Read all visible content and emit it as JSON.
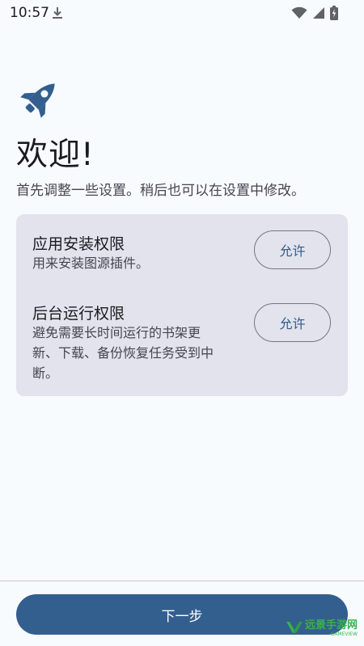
{
  "status_bar": {
    "time": "10:57"
  },
  "welcome": {
    "title": "欢迎!",
    "subtitle": "首先调整一些设置。稍后也可以在设置中修改。"
  },
  "permissions": [
    {
      "title": "应用安装权限",
      "description_lines": [
        "用来安装图源插件。"
      ],
      "button_label": "允许"
    },
    {
      "title": "后台运行权限",
      "description_lines": [
        "避免需要长时间运行的书架更",
        "新、下载、备份恢复任务受到中",
        "断。"
      ],
      "button_label": "允许"
    }
  ],
  "footer": {
    "next_label": "下一步"
  },
  "watermark": {
    "text": "远景手游网",
    "sub": "GAMEVIEW"
  },
  "colors": {
    "background": "#f8fbfe",
    "card": "#e2e3ec",
    "primary": "#335f8f",
    "accent_text": "#2b5b8f",
    "watermark": "#37b24d"
  },
  "icons": {
    "app_icon": "rocket-icon",
    "download": "download-icon",
    "wifi": "wifi-icon",
    "signal": "signal-icon",
    "battery": "battery-icon"
  }
}
